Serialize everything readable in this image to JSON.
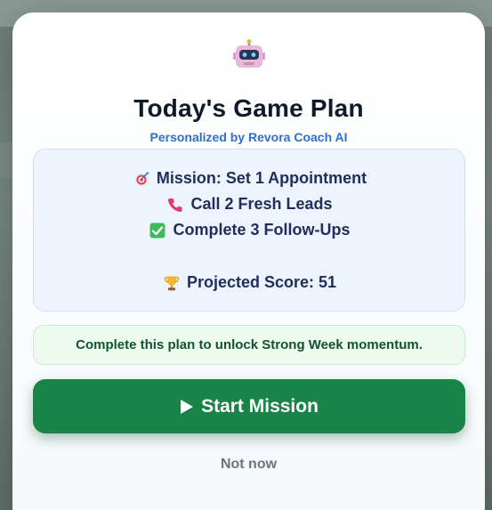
{
  "modal": {
    "icon": "robot-icon",
    "title": "Today's Game Plan",
    "subtitle": "Personalized by Revora Coach AI"
  },
  "plan": {
    "items": [
      {
        "icon": "target-icon",
        "text": "Mission: Set 1 Appointment"
      },
      {
        "icon": "phone-icon",
        "text": "Call 2 Fresh Leads"
      },
      {
        "icon": "check-box-icon",
        "text": "Complete 3 Follow-Ups"
      }
    ],
    "score": {
      "icon": "trophy-icon",
      "text": "Projected Score: 51"
    }
  },
  "callout": {
    "text": "Complete this plan to unlock Strong Week momentum."
  },
  "actions": {
    "start_label": "Start Mission",
    "start_icon": "play-icon",
    "dismiss_label": "Not now"
  },
  "colors": {
    "primary": "#1a8348",
    "accent_blue": "#2f6fd0",
    "title": "#0f1b2d",
    "plan_text": "#1f2e5a"
  }
}
